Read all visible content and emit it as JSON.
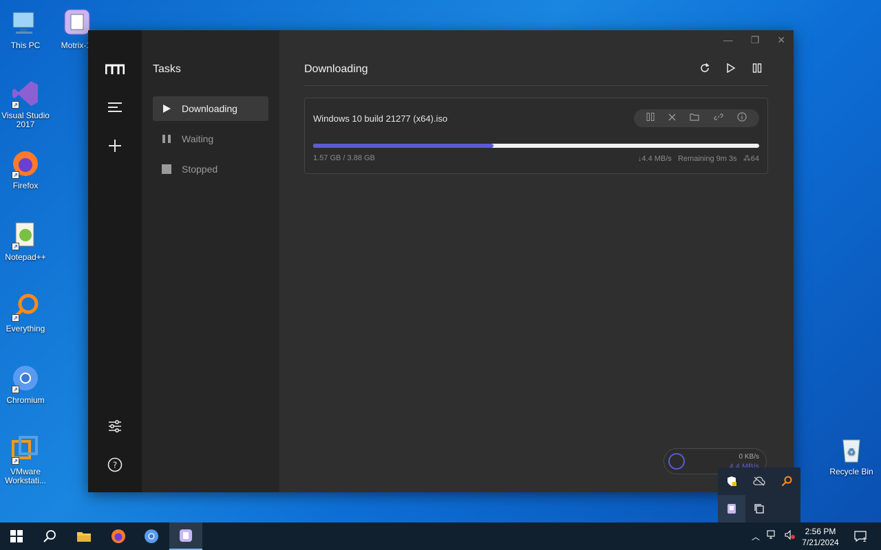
{
  "desktop": {
    "icons": [
      {
        "label": "This PC"
      },
      {
        "label": "Motrix-1."
      },
      {
        "label": "Visual Studio 2017"
      },
      {
        "label": "Firefox"
      },
      {
        "label": "Notepad++"
      },
      {
        "label": "Everything"
      },
      {
        "label": "Chromium"
      },
      {
        "label": "VMware Workstati..."
      },
      {
        "label": "Recycle Bin"
      }
    ]
  },
  "app": {
    "sidebar": {
      "title": "Tasks",
      "items": [
        {
          "label": "Downloading",
          "icon": "play-icon"
        },
        {
          "label": "Waiting",
          "icon": "pause-icon"
        },
        {
          "label": "Stopped",
          "icon": "stop-icon"
        }
      ]
    },
    "main": {
      "title": "Downloading"
    },
    "task": {
      "name": "Windows 10 build 21277 (x64).iso",
      "size": "1.57 GB / 3.88 GB",
      "progress": 0.405,
      "speed": "↓4.4 MB/s",
      "remaining": "Remaining 9m 3s",
      "connections": "64"
    },
    "speedometer": {
      "upload": "0 KB/s",
      "download": "4.4 MB/s"
    },
    "colors": {
      "accent": "#5b5bd6"
    }
  },
  "taskbar": {
    "time": "2:56 PM",
    "date": "7/21/2024",
    "notification_count": "1"
  }
}
